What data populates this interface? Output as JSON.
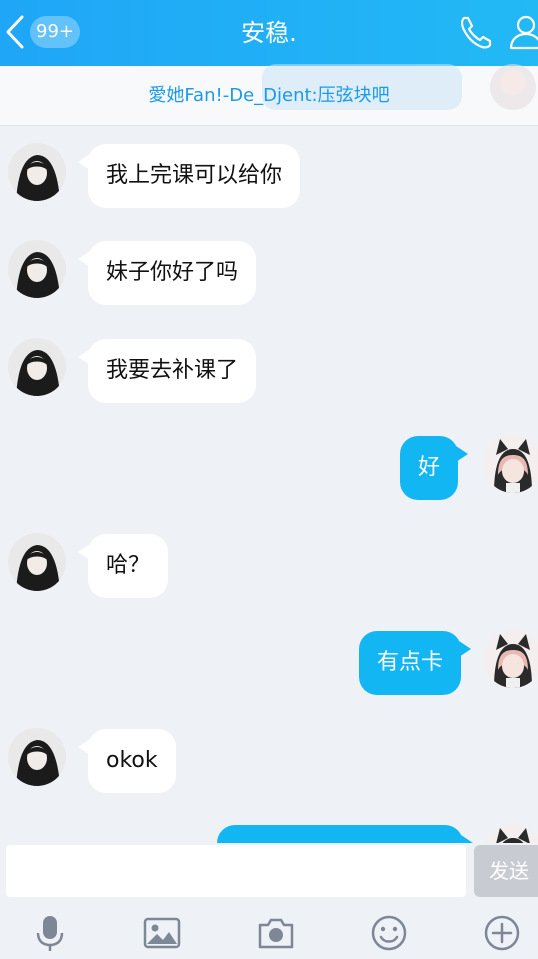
{
  "header": {
    "badge": "99+",
    "title": "安稳."
  },
  "notice": {
    "text": "愛她Fan!-De_Djent:压弦块吧"
  },
  "messages": [
    {
      "side": "left",
      "text": "我上完课可以给你"
    },
    {
      "side": "left",
      "text": "妹子你好了吗"
    },
    {
      "side": "left",
      "text": "我要去补课了"
    },
    {
      "side": "right",
      "text": "好"
    },
    {
      "side": "left",
      "text": "哈？"
    },
    {
      "side": "right",
      "text": "有点卡"
    },
    {
      "side": "left",
      "text": "okok"
    },
    {
      "side": "right",
      "text": ""
    }
  ],
  "composer": {
    "placeholder": "",
    "send_label": "发送"
  },
  "toolbar": {
    "icons": [
      "microphone-icon",
      "image-icon",
      "camera-icon",
      "emoji-icon",
      "plus-icon"
    ]
  },
  "colors": {
    "header": "#1fa6f7",
    "outgoing_bubble": "#12b6f3",
    "notice_text": "#1a9be8",
    "background": "#eef1f6"
  }
}
